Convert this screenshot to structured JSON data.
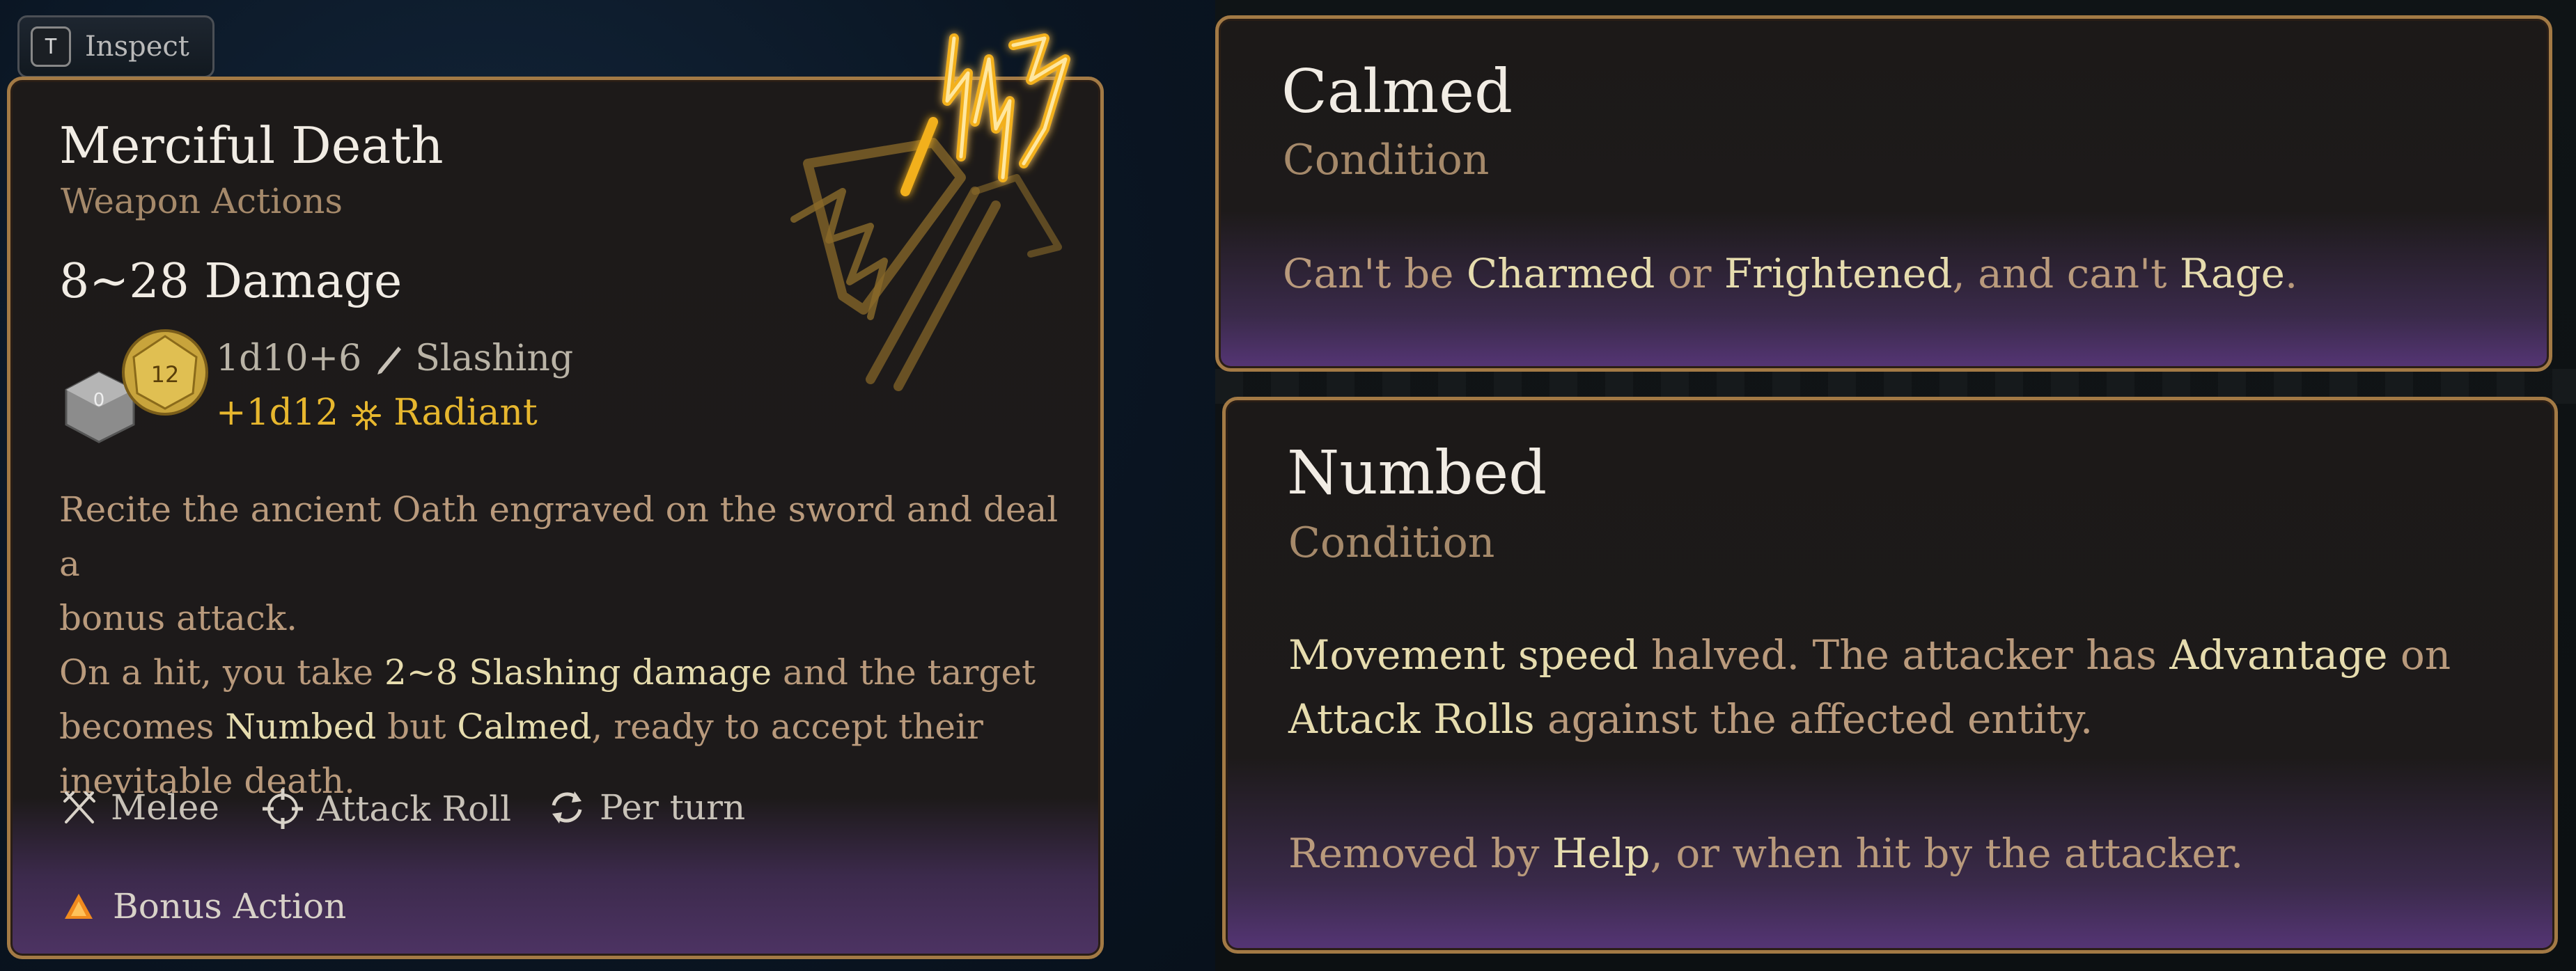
{
  "inspect": {
    "key": "T",
    "label": "Inspect"
  },
  "spell": {
    "title": "Merciful Death",
    "category": "Weapon Actions",
    "damage": "8~28 Damage",
    "dice_main": "1d10+6",
    "damage_type_main": "Slashing",
    "dice_bonus": "+1d12",
    "damage_type_bonus": "Radiant",
    "die_face_gold": "12",
    "die_face_silver": "0",
    "description": {
      "line1": "Recite the ancient Oath engraved on the sword and deal a",
      "line2": "bonus attack.",
      "line3_a": "On a hit, you take ",
      "line3_hl": "2~8 Slashing damage",
      "line3_b": " and the target",
      "line4_a": "becomes ",
      "line4_hl1": "Numbed",
      "line4_b": " but ",
      "line4_hl2": "Calmed",
      "line4_c": ", ready to accept their",
      "line5": "inevitable death."
    },
    "footer": {
      "range": "Melee",
      "roll": "Attack Roll",
      "recharge": "Per turn"
    },
    "action_cost": "Bonus Action"
  },
  "calmed": {
    "title": "Calmed",
    "type": "Condition",
    "desc_a": "Can't be ",
    "desc_hl1": "Charmed",
    "desc_b": " or ",
    "desc_hl2": "Frightened",
    "desc_c": ", and can't ",
    "desc_hl3": "Rage",
    "desc_d": "."
  },
  "numbed": {
    "title": "Numbed",
    "type": "Condition",
    "line1_hl1": "Movement speed",
    "line1_a": " halved. The attacker has ",
    "line1_hl2": "Advantage",
    "line1_b": " on",
    "line2_hl": "Attack Rolls",
    "line2_a": " against the affected entity.",
    "line3_a": "Removed by ",
    "line3_hl": "Help",
    "line3_b": ", or when hit by the attacker."
  },
  "colors": {
    "gold_text": "#e7b72e",
    "highlight": "#e6dcae",
    "border": "#a37a45",
    "subtitle": "#a5896a"
  },
  "icons": {
    "spell": "sword-lightning-icon",
    "melee": "crossed-swords-icon",
    "roll": "crosshair-icon",
    "recharge": "cycle-icon",
    "action": "triangle-icon",
    "slashing": "blade-icon",
    "radiant": "sunburst-icon"
  }
}
